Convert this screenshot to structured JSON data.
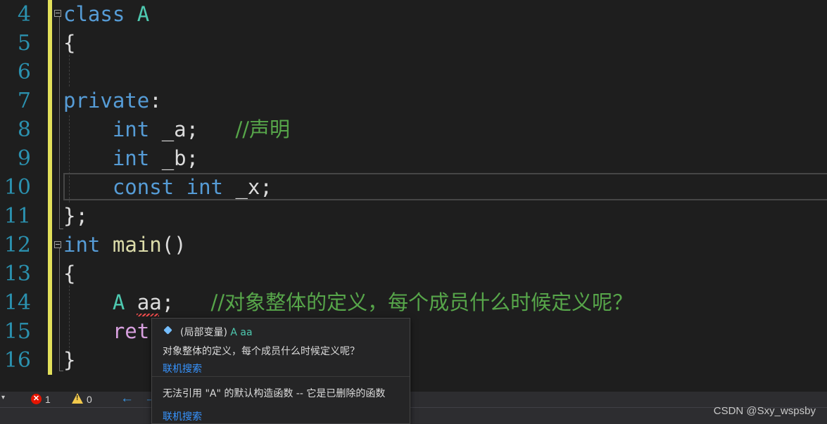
{
  "editor": {
    "lines": [
      {
        "num": "4",
        "tokens": [
          {
            "t": "class",
            "c": "kw"
          },
          {
            "t": " "
          },
          {
            "t": "A",
            "c": "ty"
          }
        ]
      },
      {
        "num": "5",
        "tokens": [
          {
            "t": "{"
          }
        ]
      },
      {
        "num": "6",
        "tokens": []
      },
      {
        "num": "7",
        "tokens": [
          {
            "t": "private",
            "c": "kw"
          },
          {
            "t": ":"
          }
        ]
      },
      {
        "num": "8",
        "tokens": [
          {
            "t": "    "
          },
          {
            "t": "int",
            "c": "kw"
          },
          {
            "t": " _a;   "
          },
          {
            "t": "//声明",
            "c": "cm"
          }
        ]
      },
      {
        "num": "9",
        "tokens": [
          {
            "t": "    "
          },
          {
            "t": "int",
            "c": "kw"
          },
          {
            "t": " _b;"
          }
        ]
      },
      {
        "num": "10",
        "tokens": [
          {
            "t": "    "
          },
          {
            "t": "const",
            "c": "kw"
          },
          {
            "t": " "
          },
          {
            "t": "int",
            "c": "kw"
          },
          {
            "t": " _x;"
          }
        ]
      },
      {
        "num": "11",
        "tokens": [
          {
            "t": "};"
          }
        ]
      },
      {
        "num": "12",
        "tokens": [
          {
            "t": "int",
            "c": "kw"
          },
          {
            "t": " "
          },
          {
            "t": "main",
            "c": "fn"
          },
          {
            "t": "()"
          }
        ]
      },
      {
        "num": "13",
        "tokens": [
          {
            "t": "{"
          }
        ]
      },
      {
        "num": "14",
        "tokens": [
          {
            "t": "    "
          },
          {
            "t": "A",
            "c": "ty"
          },
          {
            "t": " aa;   "
          },
          {
            "t": "//对象整体的定义，每个成员什么时候定义呢？",
            "c": "cm"
          }
        ]
      },
      {
        "num": "15",
        "tokens": [
          {
            "t": "    "
          },
          {
            "t": "retu",
            "c": "ret"
          }
        ]
      },
      {
        "num": "16",
        "tokens": [
          {
            "t": "}"
          }
        ]
      }
    ]
  },
  "tooltip": {
    "kind": "(局部变量)",
    "type": "A",
    "name": "aa",
    "comment": "对象整体的定义，每个成员什么时候定义呢？",
    "search_link_1": "联机搜索",
    "error_message": "无法引用 \"A\" 的默认构造函数 -- 它是已删除的函数",
    "search_link_2": "联机搜索"
  },
  "statusbar": {
    "zoom_arrow": "▾",
    "error_count": "1",
    "warning_count": "0",
    "error_glyph": "✕",
    "warning_glyph": "!",
    "nav_back": "←",
    "nav_forward": "→"
  },
  "watermark": "CSDN @Sxy_wspsby",
  "colors": {
    "keyword": "#569cd6",
    "type": "#4ec9b0",
    "comment": "#57a64a",
    "link": "#3794ff",
    "change_bar": "#e2e05a"
  }
}
